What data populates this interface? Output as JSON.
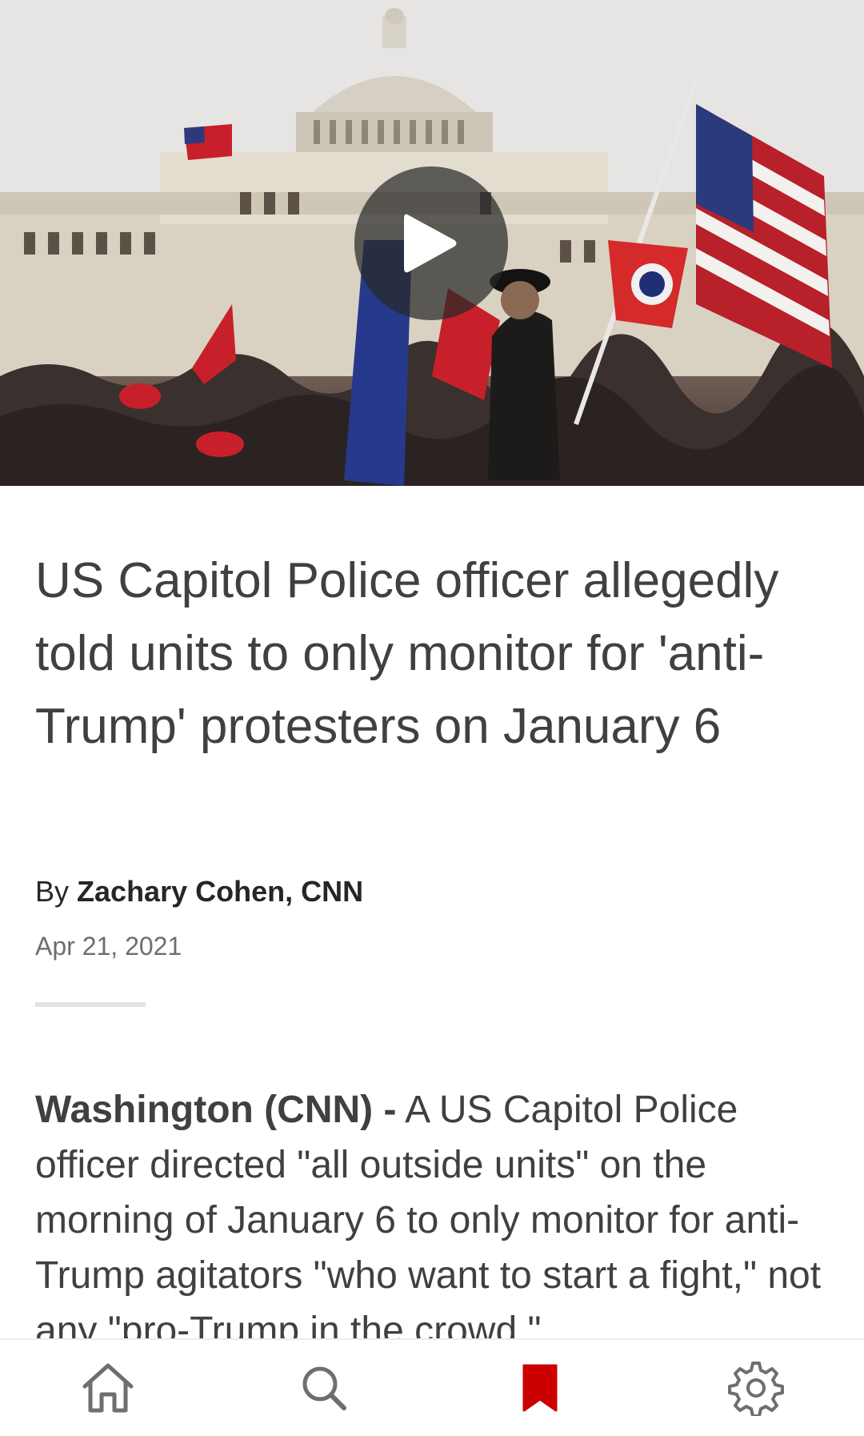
{
  "article": {
    "headline": "US Capitol Police officer allegedly told units to only monitor for 'anti-Trump' protesters on January 6",
    "byline_prefix": "By",
    "author": "Zachary Cohen, CNN",
    "date": "Apr 21, 2021",
    "dateline": "Washington  (CNN) -",
    "body": "A US Capitol Police officer directed \"all outside units\" on the morning of January 6 to only monitor for anti-Trump agitators \"who want to start a fight,\" not any \"pro-Trump in the crowd.\""
  },
  "media": {
    "icon": "play-icon"
  },
  "bottom_nav": {
    "items": [
      {
        "icon": "home-icon"
      },
      {
        "icon": "search-icon"
      },
      {
        "icon": "bookmark-icon",
        "active": true
      },
      {
        "icon": "gear-icon"
      }
    ],
    "active_color": "#cc0000",
    "inactive_color": "#6e6e6e"
  }
}
